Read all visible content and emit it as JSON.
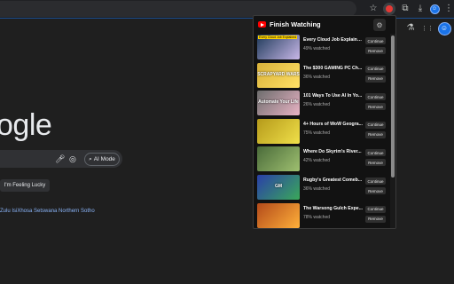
{
  "toolbar": {
    "icons": [
      "star-icon",
      "extension-active-icon",
      "extensions-puzzle-icon",
      "download-icon",
      "profile-avatar-icon",
      "menu-icon"
    ],
    "star_glyph": "☆",
    "puzzle_glyph": "⧉",
    "download_glyph": "⤓",
    "menu_glyph": "⋮"
  },
  "page": {
    "logo_text": "ogle",
    "ai_mode_label": "AI Mode",
    "lucky_label": "I'm Feeling Lucky",
    "languages_text": "Zulu IsiXhosa Setswana Northern Sotho",
    "right_icons": {
      "labs": "⚗",
      "apps": "⋮⋮",
      "avatar": "☺"
    }
  },
  "popup": {
    "title": "Finish Watching",
    "settings_glyph": "⚙",
    "continue_label": "Continue",
    "remove_label": "Remove",
    "items": [
      {
        "title": "Every Cloud Job Explaine...",
        "watched": "49% watched",
        "thumb_label": "Every Cloud Job Explained",
        "thumb_text": "",
        "thumb_color": "#1f3a5a",
        "thumb_accent": "#c8b8e8"
      },
      {
        "title": "The $300 GAMING PC Ch...",
        "watched": "36% watched",
        "thumb_label": "",
        "thumb_text": "SCRAPYARD WARS",
        "thumb_color": "#d9b23a",
        "thumb_accent": "#ffe066"
      },
      {
        "title": "101 Ways To Use AI In Yo...",
        "watched": "26% watched",
        "thumb_label": "",
        "thumb_text": "Automate Your Life",
        "thumb_color": "#6d6d6d",
        "thumb_accent": "#e9b3c4"
      },
      {
        "title": "4+ Hours of WoW Geogra...",
        "watched": "75% watched",
        "thumb_label": "",
        "thumb_text": "",
        "thumb_color": "#b59a1a",
        "thumb_accent": "#f0e04a"
      },
      {
        "title": "Where Do Skyrim's River...",
        "watched": "42% watched",
        "thumb_label": "",
        "thumb_text": "",
        "thumb_color": "#4a6b3a",
        "thumb_accent": "#9fc070"
      },
      {
        "title": "Rugby's Greatest Comeb...",
        "watched": "36% watched",
        "thumb_label": "",
        "thumb_text": "GM",
        "thumb_color": "#2a3fa8",
        "thumb_accent": "#3aa85a"
      },
      {
        "title": "The Warsong Gulch Expe...",
        "watched": "78% watched",
        "thumb_label": "",
        "thumb_text": "",
        "thumb_color": "#b34a1a",
        "thumb_accent": "#ffb03a"
      }
    ]
  }
}
